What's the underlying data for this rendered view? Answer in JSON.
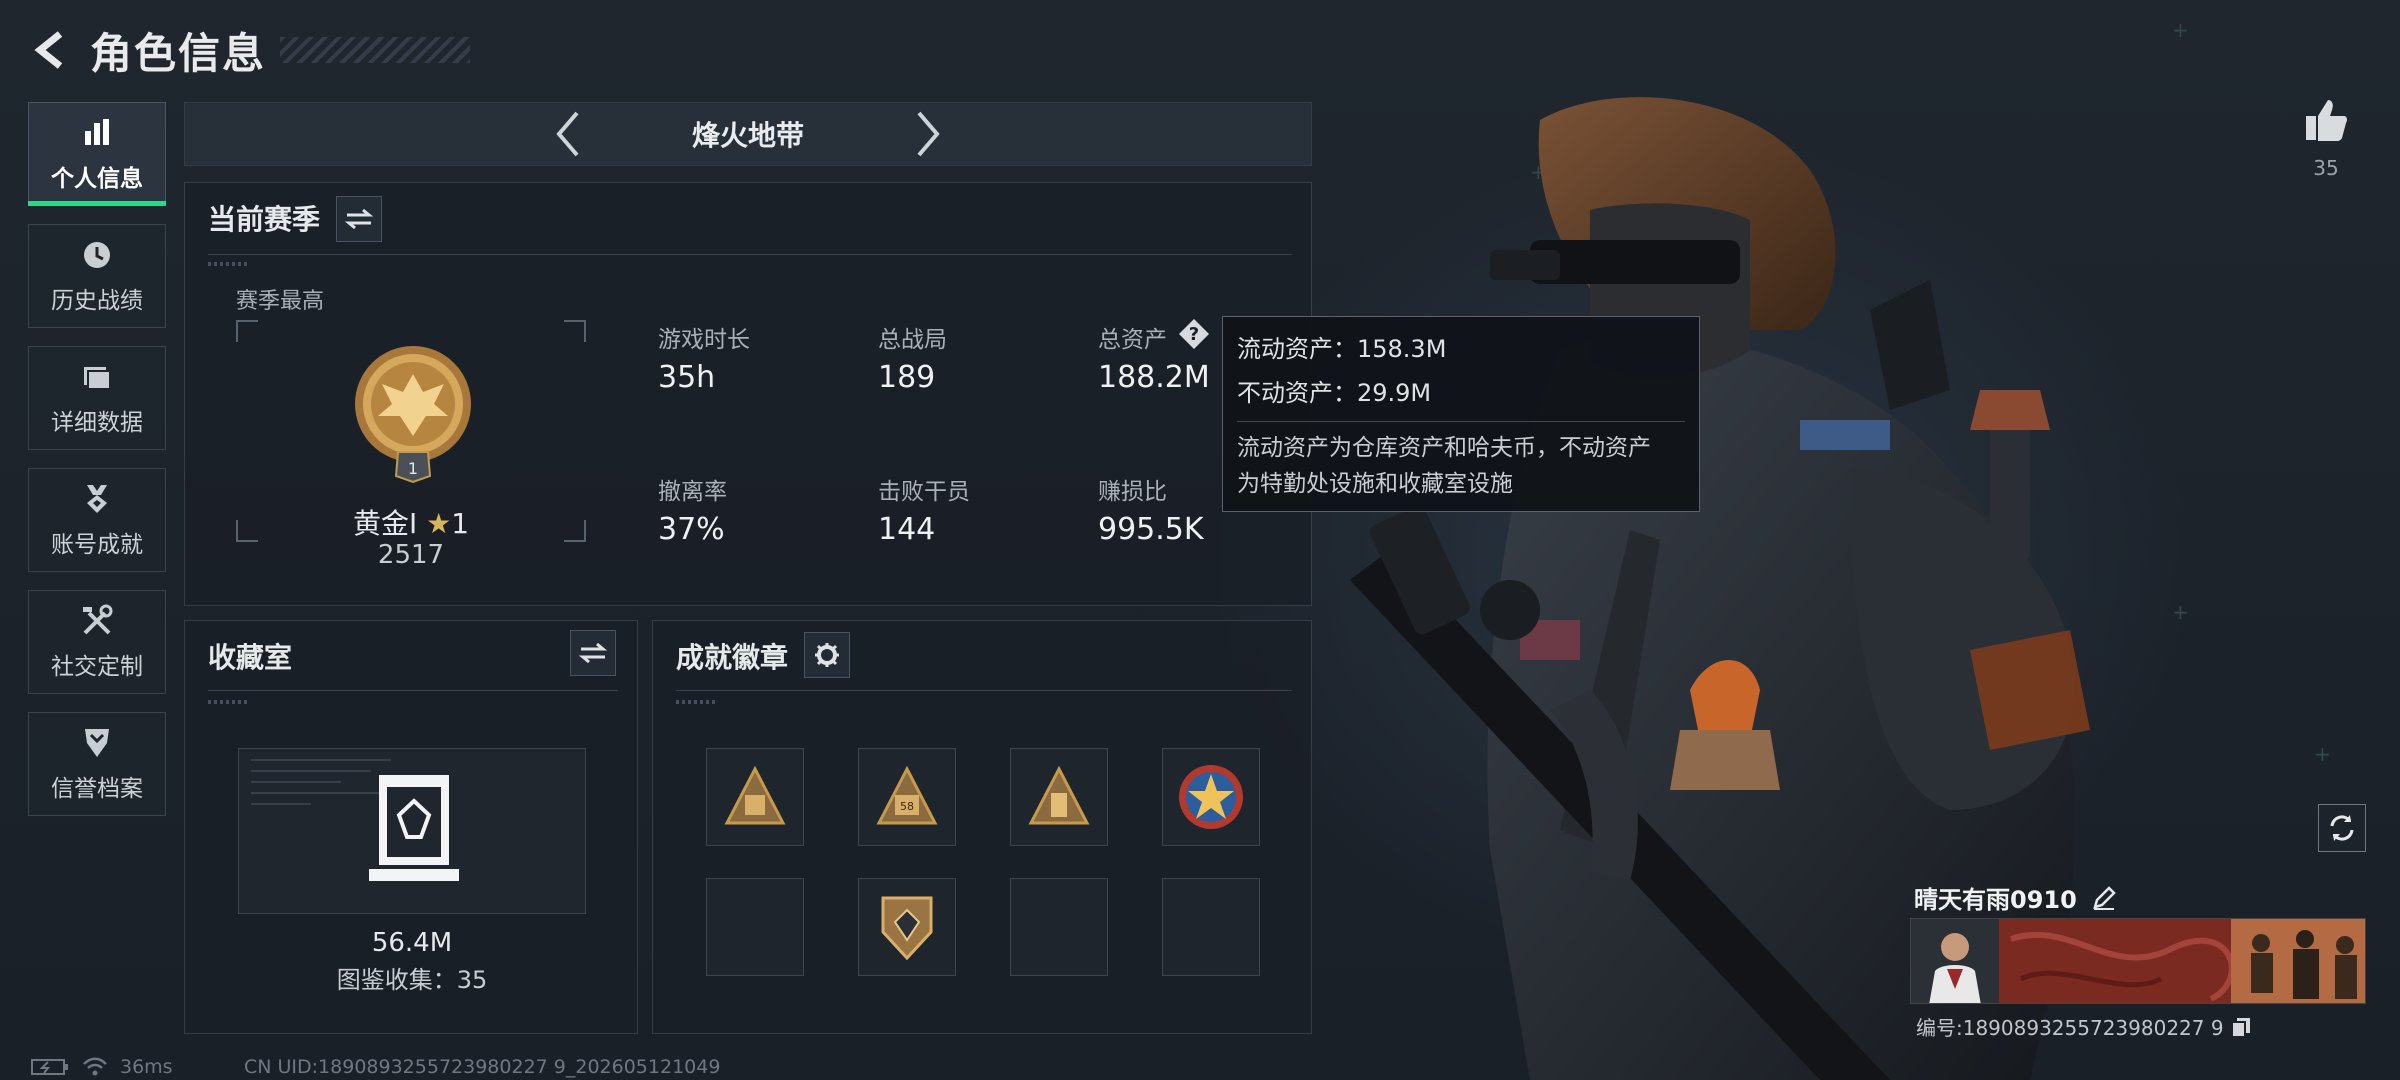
{
  "header": {
    "title": "角色信息"
  },
  "sidebar": {
    "items": [
      {
        "label": "个人信息",
        "icon": "bar-chart-icon",
        "active": true
      },
      {
        "label": "历史战绩",
        "icon": "history-clock-icon"
      },
      {
        "label": "详细数据",
        "icon": "folder-icon"
      },
      {
        "label": "账号成就",
        "icon": "achievement-medal-icon"
      },
      {
        "label": "社交定制",
        "icon": "tools-icon"
      },
      {
        "label": "信誉档案",
        "icon": "shield-chevron-icon"
      }
    ]
  },
  "map_selector": {
    "current": "烽火地带"
  },
  "season": {
    "title": "当前赛季",
    "best_label": "赛季最高",
    "rank_name": "黄金Ⅰ",
    "rank_stars": "1",
    "rank_badge_number": "1",
    "rank_score": "2517",
    "stats": [
      {
        "label": "游戏时长",
        "value": "35h"
      },
      {
        "label": "总战局",
        "value": "189"
      },
      {
        "label": "总资产",
        "value": "188.2M"
      },
      {
        "label": "撤离率",
        "value": "37%"
      },
      {
        "label": "击败干员",
        "value": "144"
      },
      {
        "label": "赚损比",
        "value": "995.5K"
      }
    ]
  },
  "asset_tooltip": {
    "liquid": "流动资产：158.3M",
    "fixed": "不动资产：29.9M",
    "desc_line1": "流动资产为仓库资产和哈夫币，不动资产",
    "desc_line2": "为特勤处设施和收藏室设施"
  },
  "collection": {
    "title": "收藏室",
    "value": "56.4M",
    "count_text": "图鉴收集：35"
  },
  "badges": {
    "title": "成就徽章",
    "slots": [
      {
        "filled": true,
        "icon": "triangle-emblem-icon"
      },
      {
        "filled": true,
        "icon": "triangle-58-emblem-icon",
        "text": "58"
      },
      {
        "filled": true,
        "icon": "triangle-box-emblem-icon"
      },
      {
        "filled": true,
        "icon": "star-seal-emblem-icon"
      },
      {
        "filled": false
      },
      {
        "filled": true,
        "icon": "shield-diamond-emblem-icon"
      },
      {
        "filled": false
      },
      {
        "filled": false
      }
    ]
  },
  "social": {
    "likes": "35"
  },
  "player": {
    "name": "晴天有雨0910",
    "id_text": "编号:1890893255723980227 9"
  },
  "footer": {
    "ping": "36ms",
    "uid": "CN UID:1890893255723980227 9_202605121049"
  },
  "colors": {
    "accent_green": "#2fd58a",
    "gold": "#c59a4a",
    "panel_border": "#343d48"
  }
}
